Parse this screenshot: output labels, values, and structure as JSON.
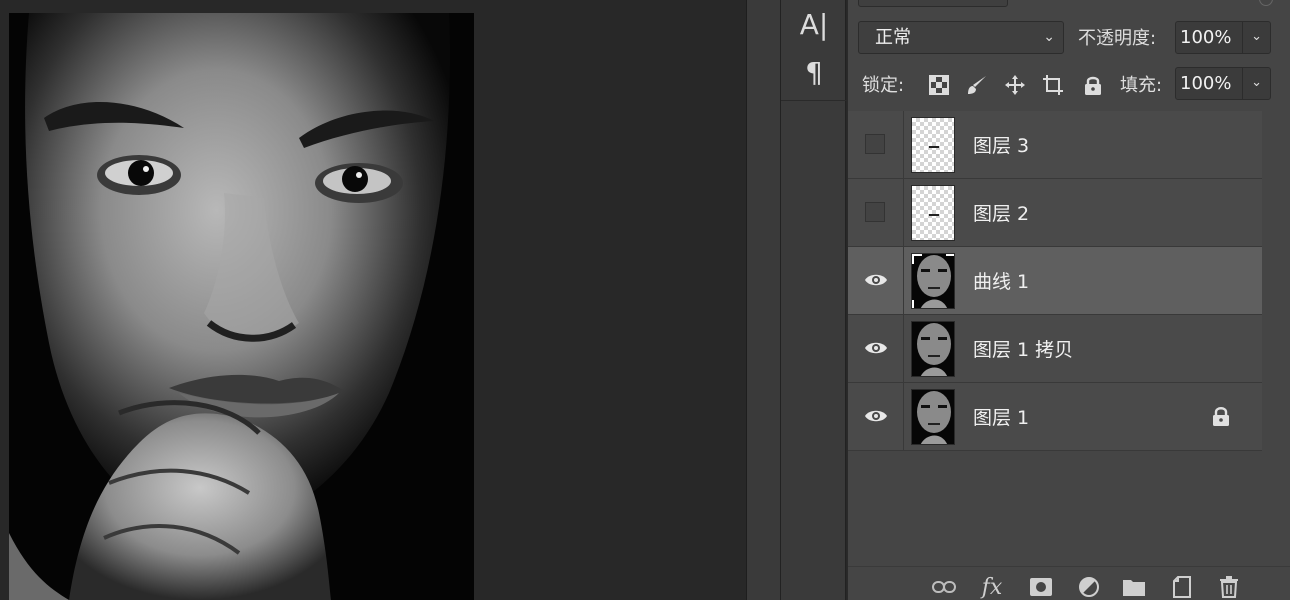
{
  "tools": {
    "type_tool_glyph": "A|",
    "paragraph_glyph": "¶"
  },
  "layers_panel": {
    "blend_mode": "正常",
    "opacity_label": "不透明度:",
    "opacity_value": "100%",
    "lock_label": "锁定:",
    "fill_label": "填充:",
    "fill_value": "100%",
    "layers": [
      {
        "name": "图层 3",
        "visible": false,
        "thumb": "transparent",
        "selected": false,
        "locked": false
      },
      {
        "name": "图层 2",
        "visible": false,
        "thumb": "transparent",
        "selected": false,
        "locked": false
      },
      {
        "name": "曲线 1",
        "visible": true,
        "thumb": "portrait",
        "selected": true,
        "locked": false
      },
      {
        "name": "图层 1 拷贝",
        "visible": true,
        "thumb": "portrait",
        "selected": false,
        "locked": false
      },
      {
        "name": "图层 1",
        "visible": true,
        "thumb": "portrait",
        "selected": false,
        "locked": true
      }
    ],
    "bottom_icons": [
      "link-icon",
      "fx-icon",
      "mask-icon",
      "adjustment-icon",
      "folder-icon",
      "new-layer-icon",
      "trash-icon"
    ],
    "fx_glyph": "fx"
  },
  "colors": {
    "panel_bg": "#454545",
    "selected_row": "#5f5f5f",
    "canvas_bg": "#282828"
  }
}
